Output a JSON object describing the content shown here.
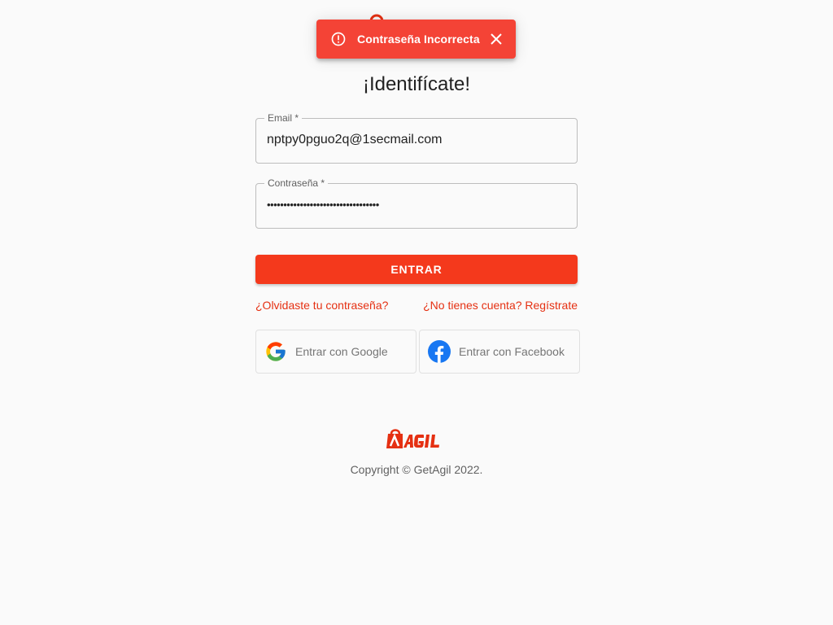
{
  "snackbar": {
    "message": "Contraseña Incorrecta",
    "icon": "alert-circle-icon",
    "color": "#f44336"
  },
  "header": {
    "title": "¡Identifícate!"
  },
  "form": {
    "email_label": "Email *",
    "email_value": "nptpy0pguo2q@1secmail.com",
    "password_label": "Contraseña *",
    "password_value": "••••••••••••••••••••••••••••••••••",
    "submit_label": "Entrar",
    "forgot_link": "¿Olvidaste tu contraseña?",
    "register_link": "¿No tienes cuenta? Regístrate"
  },
  "social": {
    "google_label": "Entrar con Google",
    "facebook_label": "Entrar con Facebook"
  },
  "footer": {
    "copyright": "Copyright © GetAgil 2022."
  },
  "colors": {
    "accent": "#f4391c",
    "link": "#e53012",
    "facebook": "#1877f2"
  }
}
